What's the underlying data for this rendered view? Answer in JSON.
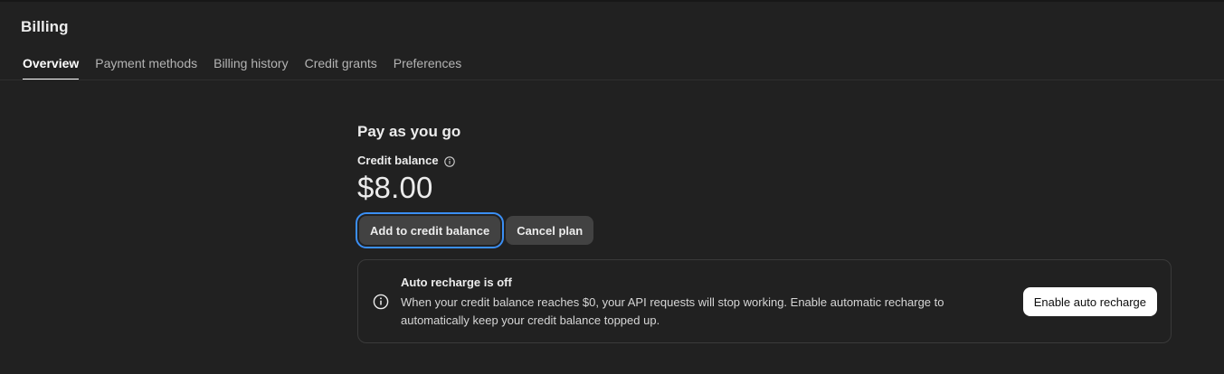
{
  "header": {
    "title": "Billing"
  },
  "tabs": [
    {
      "label": "Overview",
      "active": true
    },
    {
      "label": "Payment methods",
      "active": false
    },
    {
      "label": "Billing history",
      "active": false
    },
    {
      "label": "Credit grants",
      "active": false
    },
    {
      "label": "Preferences",
      "active": false
    }
  ],
  "plan": {
    "title": "Pay as you go",
    "credit_balance_label": "Credit balance",
    "credit_balance_value": "$8.00",
    "add_button_label": "Add to credit balance",
    "cancel_button_label": "Cancel plan"
  },
  "notice": {
    "title": "Auto recharge is off",
    "body": "When your credit balance reaches $0, your API requests will stop working. Enable automatic recharge to automatically keep your credit balance topped up.",
    "button_label": "Enable auto recharge",
    "icon": "info-icon"
  },
  "colors": {
    "background": "#212121",
    "focus_ring": "#3b8ff5",
    "button_dark": "#424242",
    "button_light": "#ffffff"
  }
}
